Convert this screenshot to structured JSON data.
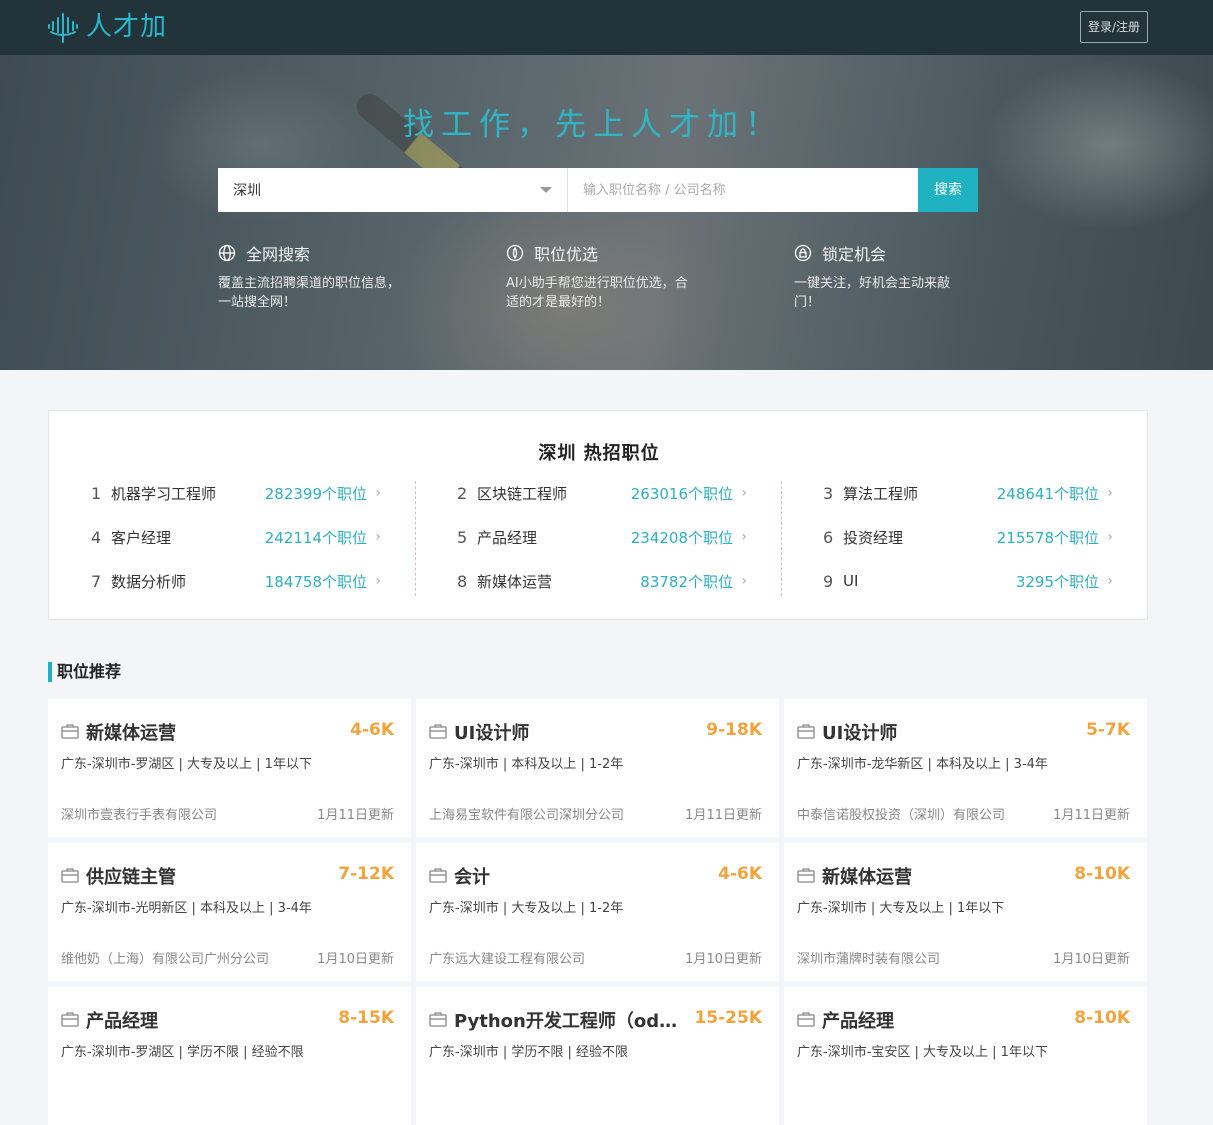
{
  "header": {
    "logo_text": "人才加",
    "login_label": "登录/注册"
  },
  "hero": {
    "title": "找工作，先上人才加！",
    "city_value": "深圳",
    "keyword_placeholder": "输入职位名称 / 公司名称",
    "search_label": "搜索",
    "features": [
      {
        "icon": "globe-icon",
        "title": "全网搜索",
        "desc": "覆盖主流招聘渠道的职位信息，一站搜全网！"
      },
      {
        "icon": "filter-icon",
        "title": "职位优选",
        "desc": "AI小助手帮您进行职位优选，合适的才是最好的！"
      },
      {
        "icon": "lock-icon",
        "title": "锁定机会",
        "desc": "一键关注，好机会主动来敲门！"
      }
    ]
  },
  "hot": {
    "title": "深圳  热招职位",
    "items": [
      {
        "rank": "1",
        "name": "机器学习工程师",
        "count": "282399个职位"
      },
      {
        "rank": "4",
        "name": "客户经理",
        "count": "242114个职位"
      },
      {
        "rank": "7",
        "name": "数据分析师",
        "count": "184758个职位"
      },
      {
        "rank": "2",
        "name": "区块链工程师",
        "count": "263016个职位"
      },
      {
        "rank": "5",
        "name": "产品经理",
        "count": "234208个职位"
      },
      {
        "rank": "8",
        "name": "新媒体运营",
        "count": "83782个职位"
      },
      {
        "rank": "3",
        "name": "算法工程师",
        "count": "248641个职位"
      },
      {
        "rank": "6",
        "name": "投资经理",
        "count": "215578个职位"
      },
      {
        "rank": "9",
        "name": "UI",
        "count": "3295个职位"
      }
    ]
  },
  "recommend": {
    "title": "职位推荐",
    "jobs": [
      {
        "title": "新媒体运营",
        "salary": "4-6K",
        "meta": "广东-深圳市-罗湖区 | 大专及以上 | 1年以下",
        "company": "深圳市壹表行手表有限公司",
        "updated": "1月11日更新"
      },
      {
        "title": "UI设计师",
        "salary": "9-18K",
        "meta": "广东-深圳市 | 本科及以上 | 1-2年",
        "company": "上海易宝软件有限公司深圳分公司",
        "updated": "1月11日更新"
      },
      {
        "title": "UI设计师",
        "salary": "5-7K",
        "meta": "广东-深圳市-龙华新区 | 本科及以上 | 3-4年",
        "company": "中泰信诺股权投资（深圳）有限公司",
        "updated": "1月11日更新"
      },
      {
        "title": "供应链主管",
        "salary": "7-12K",
        "meta": "广东-深圳市-光明新区 | 本科及以上 | 3-4年",
        "company": "维他奶（上海）有限公司广州分公司",
        "updated": "1月10日更新"
      },
      {
        "title": "会计",
        "salary": "4-6K",
        "meta": "广东-深圳市 | 大专及以上 | 1-2年",
        "company": "广东远大建设工程有限公司",
        "updated": "1月10日更新"
      },
      {
        "title": "新媒体运营",
        "salary": "8-10K",
        "meta": "广东-深圳市 | 大专及以上 | 1年以下",
        "company": "深圳市蒲牌时装有限公司",
        "updated": "1月10日更新"
      },
      {
        "title": "产品经理",
        "salary": "8-15K",
        "meta": "广东-深圳市-罗湖区 | 学历不限 | 经验不限",
        "company": "",
        "updated": ""
      },
      {
        "title": "Python开发工程师（odo…",
        "salary": "15-25K",
        "meta": "广东-深圳市 | 学历不限 | 经验不限",
        "company": "",
        "updated": ""
      },
      {
        "title": "产品经理",
        "salary": "8-10K",
        "meta": "广东-深圳市-宝安区 | 大专及以上 | 1年以下",
        "company": "",
        "updated": ""
      }
    ]
  },
  "colors": {
    "header_bg": "#22343a",
    "accent": "#20b2c1",
    "salary": "#f3a33c",
    "page_bg": "#f4f5f7"
  }
}
